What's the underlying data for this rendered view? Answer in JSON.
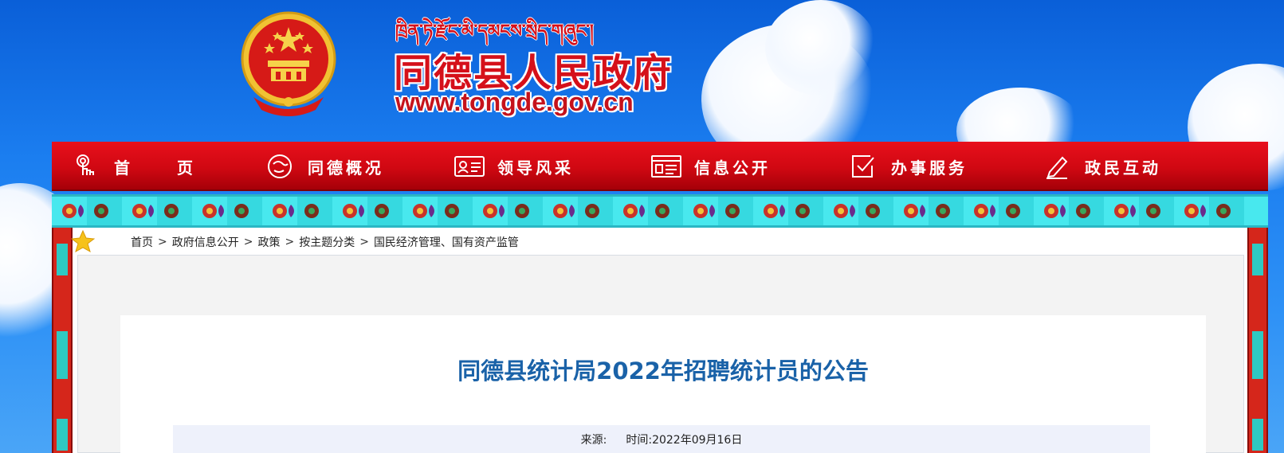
{
  "header": {
    "tibetan_name": "ཁྲིན་ཏེ་རྫོང་མི་དམངས་སྲིད་གཞུང་།",
    "site_title": "同德县人民政府",
    "site_url": "www.tongde.gov.cn"
  },
  "nav": {
    "items": [
      {
        "label": "首 页",
        "icon": "touch-icon"
      },
      {
        "label": "同德概况",
        "icon": "profile-icon"
      },
      {
        "label": "领导风采",
        "icon": "id-card-icon"
      },
      {
        "label": "信息公开",
        "icon": "document-icon"
      },
      {
        "label": "办事服务",
        "icon": "checkbox-icon"
      },
      {
        "label": "政民互动",
        "icon": "pen-icon"
      }
    ],
    "colors": {
      "bar": "#d00812",
      "text": "#ffffff"
    }
  },
  "breadcrumb": {
    "items": [
      "首页",
      "政府信息公开",
      "政策",
      "按主题分类",
      "国民经济管理、国有资产监管"
    ],
    "separator": ">"
  },
  "article": {
    "title": "同德县统计局2022年招聘统计员的公告",
    "source_label": "来源:",
    "source_value": "",
    "time_label": "时间:",
    "time_value": "2022年09月16日"
  },
  "colors": {
    "sky": "#1b7ef0",
    "title_red": "#d5101a",
    "article_title": "#1a62a8",
    "deco_cyan": "#48e8ee",
    "side_red": "#d5261b"
  }
}
